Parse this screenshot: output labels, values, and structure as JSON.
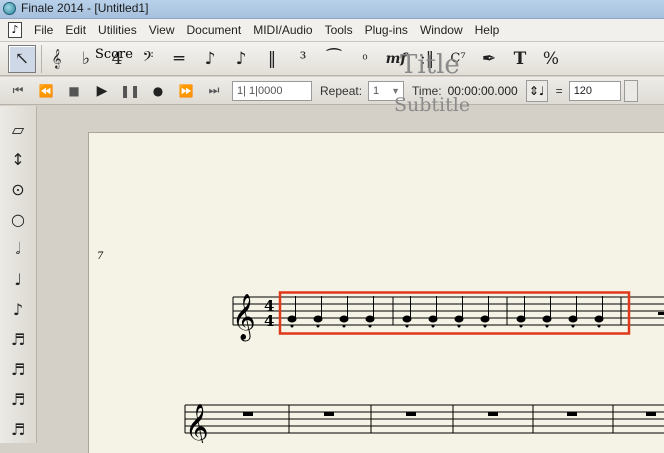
{
  "window": {
    "title": "Finale 2014 - [Untitled1]"
  },
  "menu": {
    "items": [
      "File",
      "Edit",
      "Utilities",
      "View",
      "Document",
      "MIDI/Audio",
      "Tools",
      "Plug-ins",
      "Window",
      "Help"
    ]
  },
  "toolbar": {
    "tools": [
      {
        "name": "selection-tool",
        "glyph": "↖"
      },
      {
        "name": "staff-tool",
        "glyph": "𝄞"
      },
      {
        "name": "key-signature-tool",
        "glyph": "♭"
      },
      {
        "name": "time-signature-tool",
        "glyph": "4"
      },
      {
        "name": "clef-tool",
        "glyph": "𝄢"
      },
      {
        "name": "measure-tool",
        "glyph": "═"
      },
      {
        "name": "simple-entry-tool",
        "glyph": "♪"
      },
      {
        "name": "speedy-entry-tool",
        "glyph": "♪"
      },
      {
        "name": "hyperscribe-tool",
        "glyph": "‖"
      },
      {
        "name": "tuplet-tool",
        "glyph": "³"
      },
      {
        "name": "smart-shape-tool",
        "glyph": "⁀"
      },
      {
        "name": "articulation-tool",
        "glyph": "ͦ"
      },
      {
        "name": "expression-tool",
        "glyph": "mf"
      },
      {
        "name": "repeat-tool",
        "glyph": ":‖"
      },
      {
        "name": "chord-tool",
        "glyph": "C⁷"
      },
      {
        "name": "lyrics-tool",
        "glyph": "✒"
      },
      {
        "name": "text-tool",
        "glyph": "T"
      },
      {
        "name": "resize-tool",
        "glyph": "%"
      }
    ]
  },
  "playback": {
    "counter": "1| 1|0000",
    "repeat_label": "Repeat:",
    "repeat_value": "1",
    "time_label": "Time:",
    "time_value": "00:00:00.000",
    "equals": "=",
    "tempo": "120"
  },
  "palette": {
    "tools": [
      {
        "name": "eraser-tool",
        "glyph": "▱"
      },
      {
        "name": "half-step-tool",
        "glyph": "↕"
      },
      {
        "name": "tie-tool",
        "glyph": "⊙"
      },
      {
        "name": "whole-note-tool",
        "glyph": "○"
      },
      {
        "name": "half-note-tool",
        "glyph": "𝅗𝅥"
      },
      {
        "name": "quarter-note-tool",
        "glyph": "♩"
      },
      {
        "name": "eighth-note-tool",
        "glyph": "♪"
      },
      {
        "name": "sixteenth-note-tool",
        "glyph": "♬"
      },
      {
        "name": "32nd-note-tool",
        "glyph": "♬"
      },
      {
        "name": "64th-note-tool",
        "glyph": "♬"
      },
      {
        "name": "128th-note-tool",
        "glyph": "♬"
      }
    ]
  },
  "score": {
    "label": "Score",
    "title": "Title",
    "subtitle": "Subtitle",
    "time_signature_top": "4",
    "time_signature_bottom": "4",
    "system2_measure_number": "7",
    "selection_color": "#e0381a"
  }
}
